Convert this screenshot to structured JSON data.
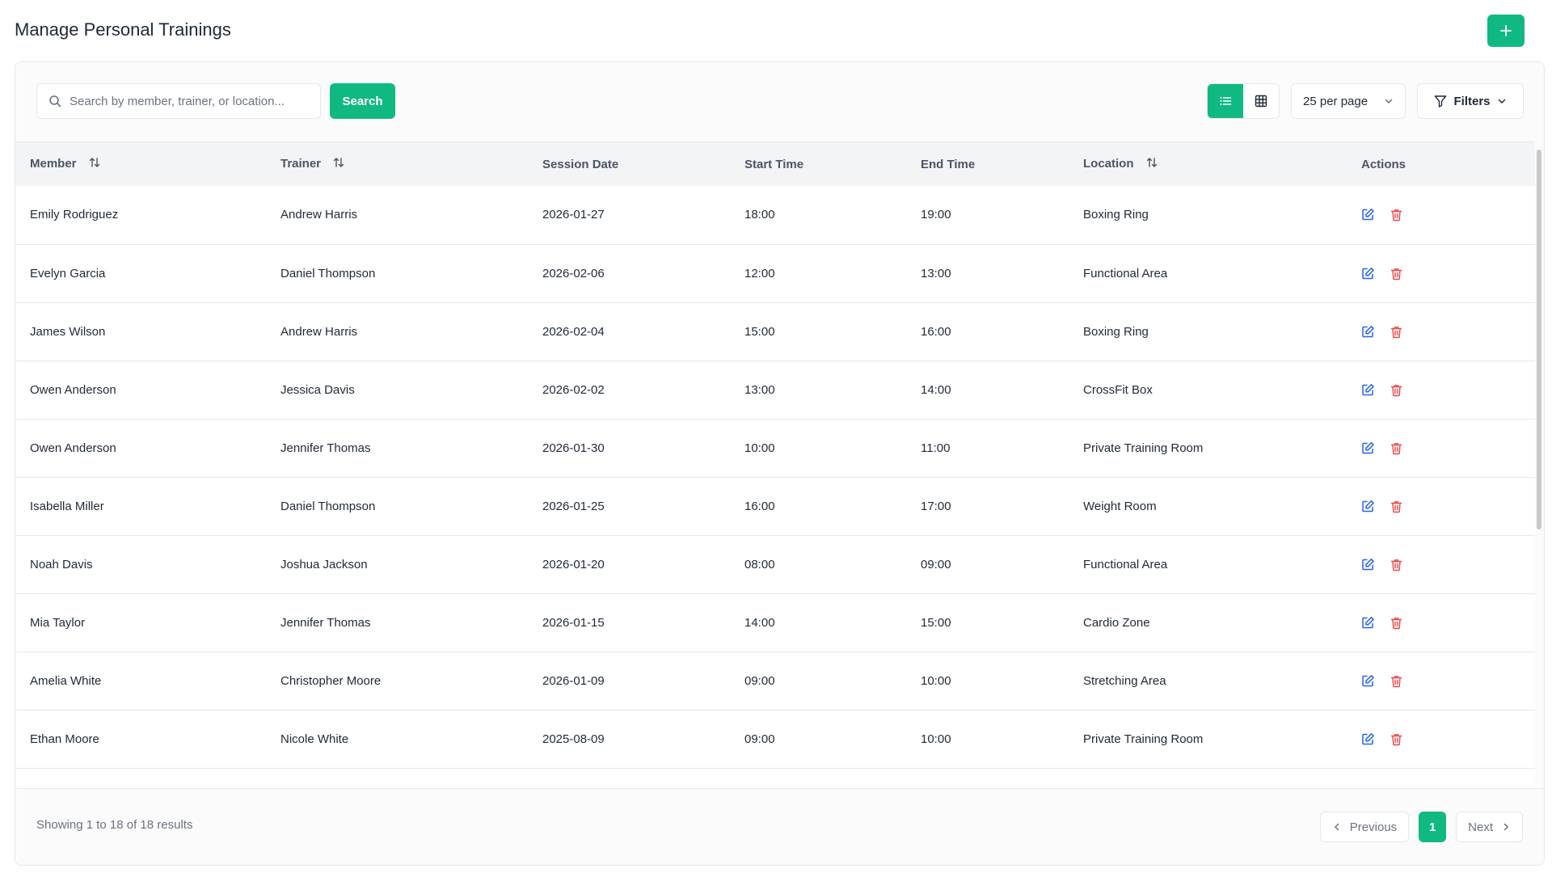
{
  "header": {
    "title": "Manage Personal Trainings",
    "add_icon": "plus-icon"
  },
  "toolbar": {
    "search_placeholder": "Search by member, trainer, or location...",
    "search_value": "",
    "search_label": "Search",
    "per_page": "25 per page",
    "filters_label": "Filters",
    "active_view": "list"
  },
  "table": {
    "columns": [
      "Member",
      "Trainer",
      "Session Date",
      "Start Time",
      "End Time",
      "Location",
      "Actions"
    ],
    "sortable": [
      "Member",
      "Trainer",
      "Location"
    ],
    "rows": [
      {
        "member": "Emily Rodriguez",
        "trainer": "Andrew Harris",
        "date": "2026-01-27",
        "start": "18:00",
        "end": "19:00",
        "location": "Boxing Ring"
      },
      {
        "member": "Evelyn Garcia",
        "trainer": "Daniel Thompson",
        "date": "2026-02-06",
        "start": "12:00",
        "end": "13:00",
        "location": "Functional Area"
      },
      {
        "member": "James Wilson",
        "trainer": "Andrew Harris",
        "date": "2026-02-04",
        "start": "15:00",
        "end": "16:00",
        "location": "Boxing Ring"
      },
      {
        "member": "Owen Anderson",
        "trainer": "Jessica Davis",
        "date": "2026-02-02",
        "start": "13:00",
        "end": "14:00",
        "location": "CrossFit Box"
      },
      {
        "member": "Owen Anderson",
        "trainer": "Jennifer Thomas",
        "date": "2026-01-30",
        "start": "10:00",
        "end": "11:00",
        "location": "Private Training Room"
      },
      {
        "member": "Isabella Miller",
        "trainer": "Daniel Thompson",
        "date": "2026-01-25",
        "start": "16:00",
        "end": "17:00",
        "location": "Weight Room"
      },
      {
        "member": "Noah Davis",
        "trainer": "Joshua Jackson",
        "date": "2026-01-20",
        "start": "08:00",
        "end": "09:00",
        "location": "Functional Area"
      },
      {
        "member": "Mia Taylor",
        "trainer": "Jennifer Thomas",
        "date": "2026-01-15",
        "start": "14:00",
        "end": "15:00",
        "location": "Cardio Zone"
      },
      {
        "member": "Amelia White",
        "trainer": "Christopher Moore",
        "date": "2026-01-09",
        "start": "09:00",
        "end": "10:00",
        "location": "Stretching Area"
      },
      {
        "member": "Ethan Moore",
        "trainer": "Nicole White",
        "date": "2025-08-09",
        "start": "09:00",
        "end": "10:00",
        "location": "Private Training Room"
      }
    ]
  },
  "footer": {
    "summary": "Showing 1 to 18 of 18 results",
    "previous": "Previous",
    "next": "Next",
    "current_page": "1"
  },
  "colors": {
    "accent": "#10b981",
    "edit": "#2563eb",
    "delete": "#ef4444"
  }
}
